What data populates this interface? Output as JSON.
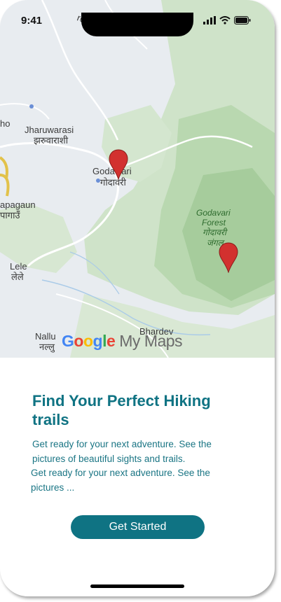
{
  "status_bar": {
    "time": "9:41"
  },
  "map": {
    "labels": {
      "partial_top": "ro",
      "partial_left_1": "ho",
      "jharuwarasi_en": "Jharuwarasi",
      "jharuwarasi_ne": "झरुवाराशी",
      "godawari_en": "Godawari",
      "godawari_ne": "गोदावरी",
      "apagaun_en": "apagaun",
      "apagaun_ne": "पागाउँ",
      "godavari_forest_1": "Godavari",
      "godavari_forest_2": "Forest",
      "godavari_forest_ne_1": "गोदावरी",
      "godavari_forest_ne_2": "जंगल",
      "lele_en": "Lele",
      "lele_ne": "लेले",
      "nallu_en": "Nallu",
      "nallu_ne": "नल्लु",
      "bhardev_en": "Bhardev"
    },
    "watermark": {
      "google": "Google",
      "mymaps": "My Maps"
    },
    "pin_color": "#d2312f"
  },
  "onboarding": {
    "title": "Find  Your Perfect Hiking trails",
    "description_1": "Get ready for your next adventure. See the pictures of beautiful sights and trails.",
    "description_2": "Get ready for your next adventure. See the pictures ...",
    "cta_label": "Get Started"
  },
  "colors": {
    "accent": "#0f7383"
  }
}
